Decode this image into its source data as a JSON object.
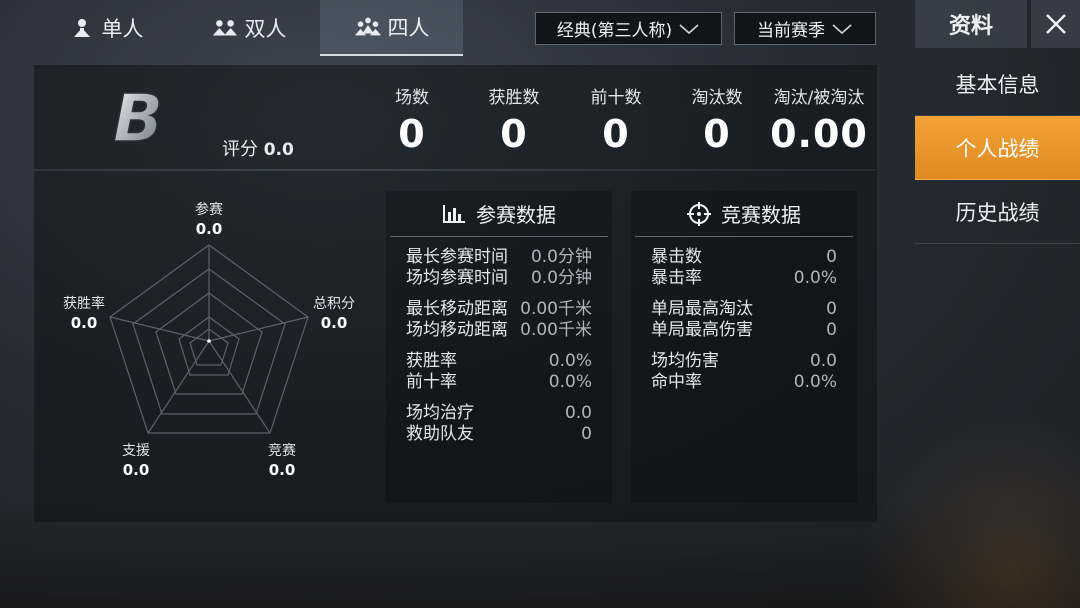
{
  "mode_tabs": [
    {
      "label": "单人"
    },
    {
      "label": "双人"
    },
    {
      "label": "四人"
    }
  ],
  "dropdowns": {
    "mode": "经典(第三人称)",
    "season": "当前赛季"
  },
  "sidebar": {
    "title": "资料",
    "items": [
      {
        "label": "基本信息"
      },
      {
        "label": "个人战绩"
      },
      {
        "label": "历史战绩"
      }
    ]
  },
  "summary": {
    "rank": "B",
    "score_label": "评分",
    "score_value": "0.0",
    "stats": [
      {
        "label": "场数",
        "value": "0"
      },
      {
        "label": "获胜数",
        "value": "0"
      },
      {
        "label": "前十数",
        "value": "0"
      },
      {
        "label": "淘汰数",
        "value": "0"
      },
      {
        "label": "淘汰/被淘汰",
        "value": "0.00"
      }
    ]
  },
  "radar": {
    "axes": [
      {
        "label": "参赛",
        "value": "0.0"
      },
      {
        "label": "总积分",
        "value": "0.0"
      },
      {
        "label": "竞赛",
        "value": "0.0"
      },
      {
        "label": "支援",
        "value": "0.0"
      },
      {
        "label": "获胜率",
        "value": "0.0"
      }
    ]
  },
  "participation": {
    "title": "参赛数据",
    "groups": [
      [
        {
          "label": "最长参赛时间",
          "value": "0.0分钟"
        },
        {
          "label": "场均参赛时间",
          "value": "0.0分钟"
        }
      ],
      [
        {
          "label": "最长移动距离",
          "value": "0.00千米"
        },
        {
          "label": "场均移动距离",
          "value": "0.00千米"
        }
      ],
      [
        {
          "label": "获胜率",
          "value": "0.0%"
        },
        {
          "label": "前十率",
          "value": "0.0%"
        }
      ],
      [
        {
          "label": "场均治疗",
          "value": "0.0"
        },
        {
          "label": "救助队友",
          "value": "0"
        }
      ]
    ]
  },
  "combat": {
    "title": "竞赛数据",
    "groups": [
      [
        {
          "label": "暴击数",
          "value": "0"
        },
        {
          "label": "暴击率",
          "value": "0.0%"
        }
      ],
      [
        {
          "label": "单局最高淘汰",
          "value": "0"
        },
        {
          "label": "单局最高伤害",
          "value": "0"
        }
      ],
      [
        {
          "label": "场均伤害",
          "value": "0.0"
        },
        {
          "label": "命中率",
          "value": "0.0%"
        }
      ]
    ]
  },
  "colors": {
    "accent": "#e8952a",
    "panel": "#0e1216"
  }
}
